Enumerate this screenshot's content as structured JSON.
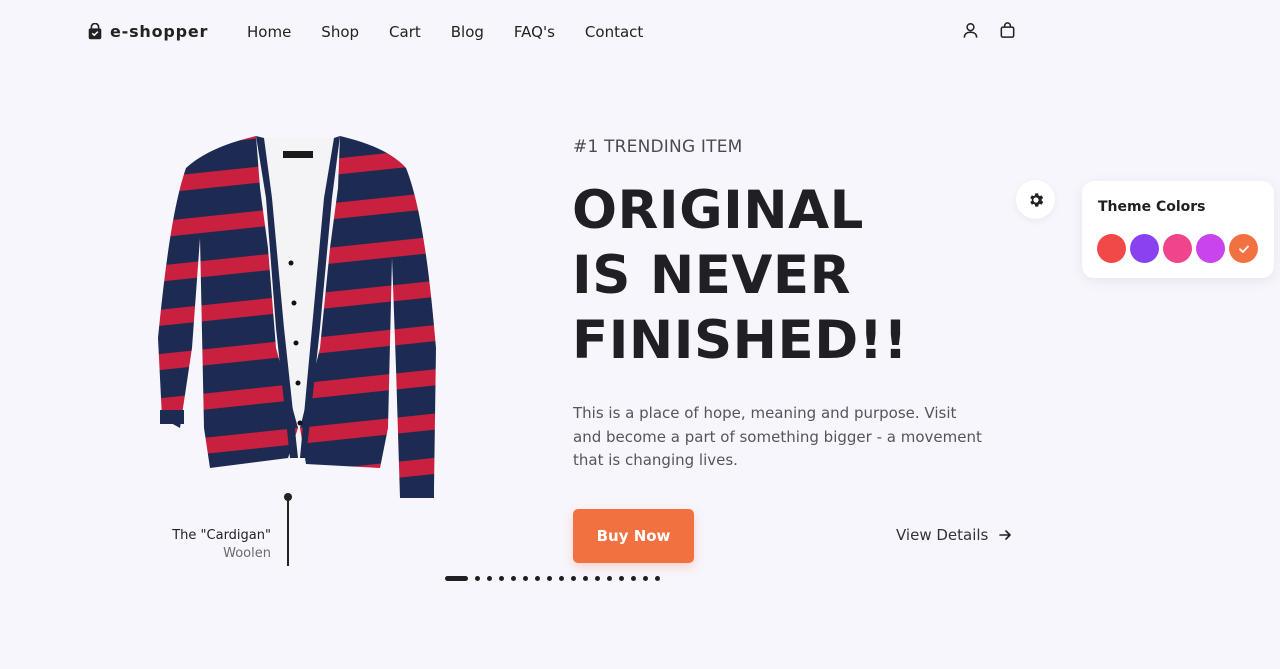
{
  "brand": {
    "name": "e-shopper",
    "logo_icon": "shopping-bag-icon"
  },
  "nav": {
    "items": [
      {
        "label": "Home"
      },
      {
        "label": "Shop"
      },
      {
        "label": "Cart"
      },
      {
        "label": "Blog"
      },
      {
        "label": "FAQ's"
      },
      {
        "label": "Contact"
      }
    ]
  },
  "header_icons": [
    "user-icon",
    "cart-bag-icon"
  ],
  "hero": {
    "eyebrow": "#1 TRENDING ITEM",
    "headline": [
      "ORIGINAL",
      "IS NEVER",
      "FINISHED!!"
    ],
    "description": "This is a place of hope, meaning and purpose. Visit and become a part of something bigger - a movement that is changing lives.",
    "buy_button": "Buy Now",
    "view_details": "View Details",
    "accent_color": "#f27140"
  },
  "product": {
    "name": "The \"Cardigan\"",
    "material": "Woolen",
    "colors": {
      "navy": "#1d2a52",
      "red": "#c8203e",
      "shirt": "#f4f4f6"
    }
  },
  "carousel": {
    "total": 17,
    "active_index": 0
  },
  "theme_panel": {
    "title": "Theme Colors",
    "swatches": [
      "#f14848",
      "#8a42f0",
      "#f0448c",
      "#c944ec",
      "#f27140"
    ],
    "selected_index": 4
  }
}
